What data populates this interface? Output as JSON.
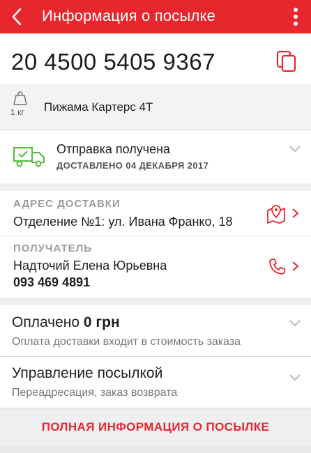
{
  "header": {
    "title": "Информация о посылке",
    "back_icon": "chevron-left-icon",
    "menu_icon": "more-vertical-icon",
    "color": "#e8262e"
  },
  "tracking": {
    "number": "20 4500 5405 9367",
    "copy_icon": "copy-icon"
  },
  "product": {
    "weight": "1 кг",
    "name": "Пижама Картерс 4Т",
    "weight_icon": "weight-icon"
  },
  "status": {
    "title": "Отправка получена",
    "subtitle": "ДОСТАВЛЕНО 04 ДЕКАБРЯ 2017",
    "icon": "delivery-truck-icon",
    "icon_color": "#55b93c"
  },
  "address": {
    "label": "АДРЕС ДОСТАВКИ",
    "value": "Отделение №1: ул. Ивана Франко, 18",
    "icon": "map-pin-icon"
  },
  "recipient": {
    "label": "ПОЛУЧАТЕЛЬ",
    "name": "Надточий Елена Юрьевна",
    "phone": "093 469 4891",
    "icon": "phone-icon"
  },
  "payment": {
    "title_prefix": "Оплачено",
    "amount": "0 грн",
    "subtitle": "Оплата доставки входит в стоимость заказа"
  },
  "manage": {
    "title": "Управление посылкой",
    "subtitle": "Переадресация, заказ возврата"
  },
  "footer": {
    "full_info": "ПОЛНАЯ ИНФОРМАЦИЯ О ПОСЫЛКЕ"
  }
}
